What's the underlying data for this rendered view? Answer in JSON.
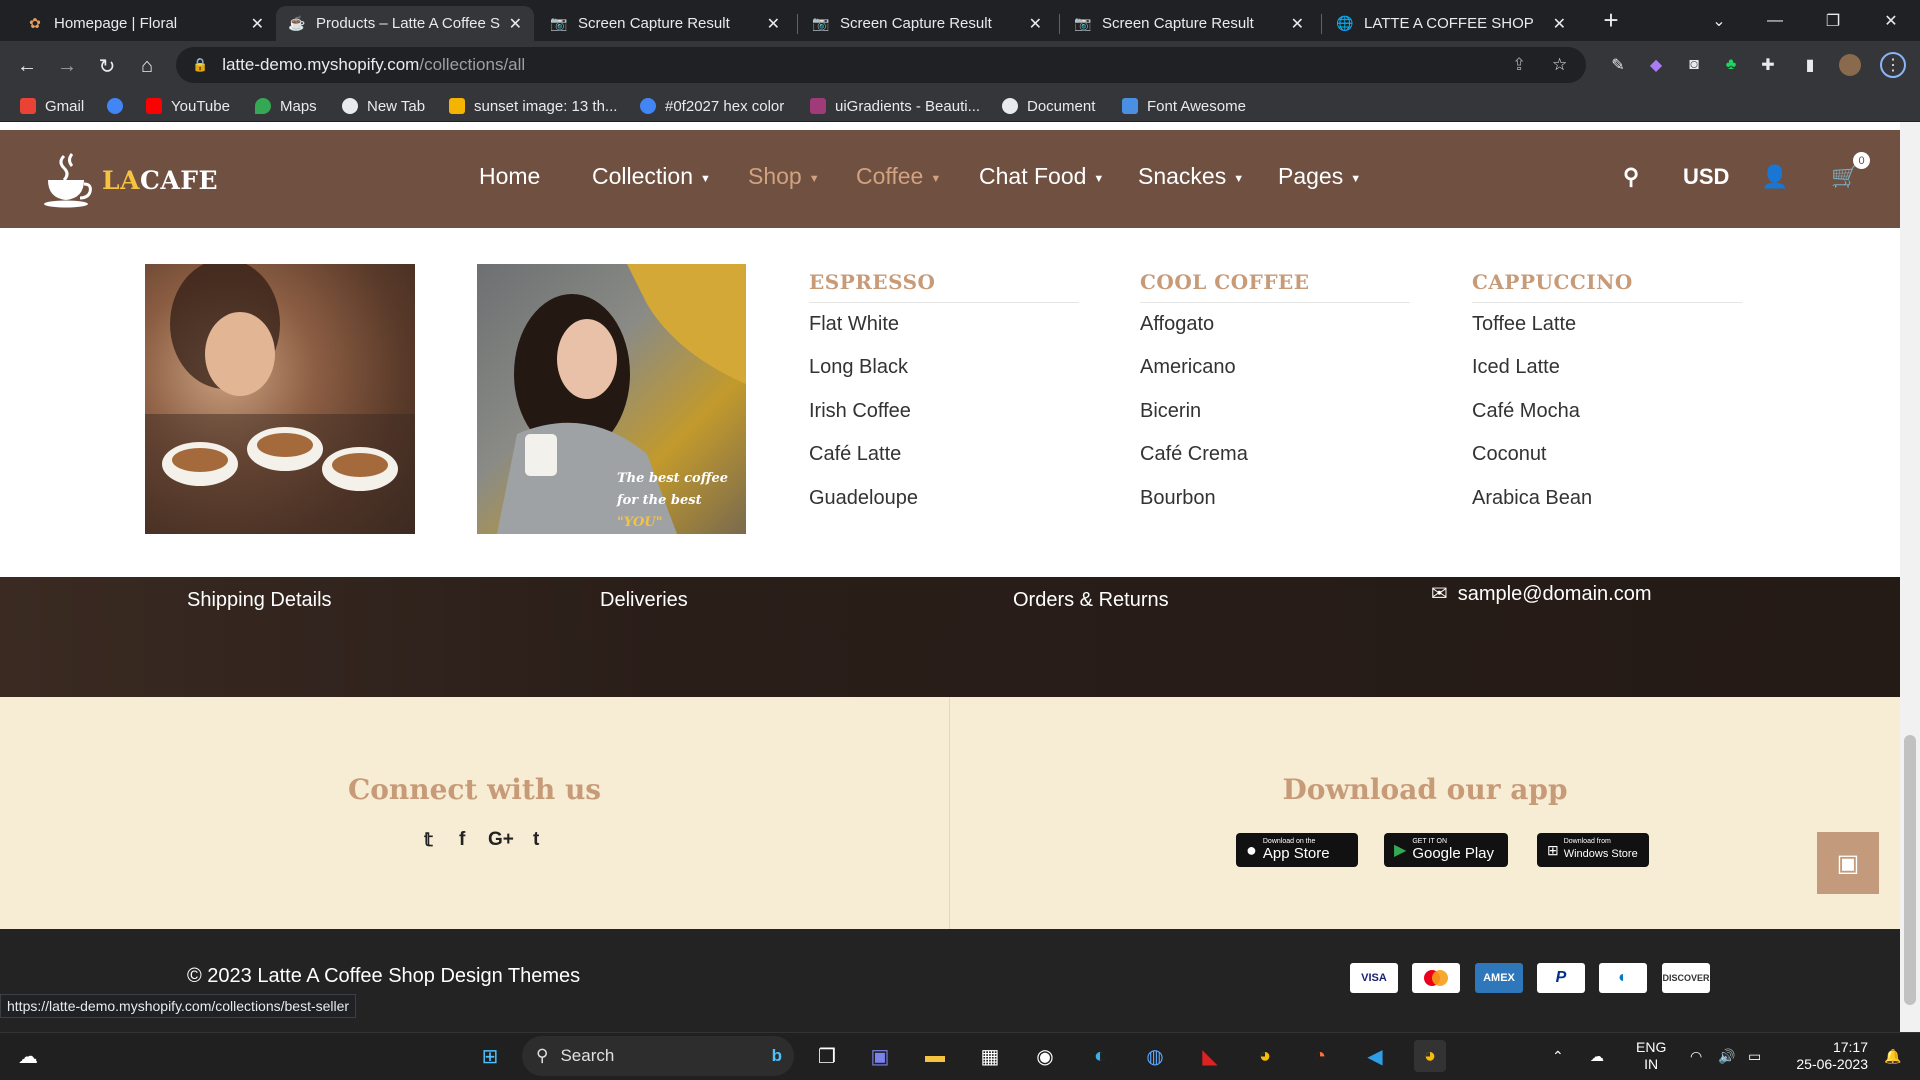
{
  "browser": {
    "tabs": [
      {
        "title": "Homepage | Floral",
        "icon": "floral-icon"
      },
      {
        "title": "Products – Latte A Coffee S",
        "icon": "coffee-icon",
        "active": true
      },
      {
        "title": "Screen Capture Result",
        "icon": "camera-icon"
      },
      {
        "title": "Screen Capture Result",
        "icon": "camera-icon"
      },
      {
        "title": "Screen Capture Result",
        "icon": "camera-icon"
      },
      {
        "title": "LATTE A COFFEE SHOP",
        "icon": "globe-icon"
      }
    ],
    "url_domain": "latte-demo.myshopify.com",
    "url_path": "/collections/all",
    "bookmarks": [
      {
        "label": "Gmail",
        "color": "#ea4335"
      },
      {
        "label": "",
        "color": "#4285f4"
      },
      {
        "label": "YouTube",
        "color": "#ff0000"
      },
      {
        "label": "Maps",
        "color": "#34a853"
      },
      {
        "label": "New Tab",
        "color": "#e8eaed"
      },
      {
        "label": "sunset image: 13 th...",
        "color": "#f4b400"
      },
      {
        "label": "#0f2027 hex color",
        "color": "#4285f4"
      },
      {
        "label": "uiGradients - Beauti...",
        "color": "#a03a78"
      },
      {
        "label": "Document",
        "color": "#e8eaed"
      },
      {
        "label": "Font Awesome",
        "color": "#4a90e2"
      }
    ],
    "status_url": "https://latte-demo.myshopify.com/collections/best-seller"
  },
  "site": {
    "logo_la": "LA",
    "logo_cafe": "CAFE",
    "nav": [
      {
        "label": "Home",
        "caret": false
      },
      {
        "label": "Collection",
        "caret": true
      },
      {
        "label": "Shop",
        "caret": true
      },
      {
        "label": "Coffee",
        "caret": true
      },
      {
        "label": "Chat Food",
        "caret": true
      },
      {
        "label": "Snackes",
        "caret": true
      },
      {
        "label": "Pages",
        "caret": true
      }
    ],
    "currency": "USD",
    "cart_count": "0",
    "promo_caption_1": "The best coffee",
    "promo_caption_2": "for the best",
    "promo_caption_3": "\"YOU\"",
    "menu_columns": [
      {
        "title": "ESPRESSO",
        "items": [
          "Flat White",
          "Long Black",
          "Irish Coffee",
          "Café Latte",
          "Guadeloupe"
        ]
      },
      {
        "title": "COOL COFFEE",
        "items": [
          "Affogato",
          "Americano",
          "Bicerin",
          "Café Crema",
          "Bourbon"
        ]
      },
      {
        "title": "CAPPUCCINO",
        "items": [
          "Toffee Latte",
          "Iced Latte",
          "Café Mocha",
          "Coconut",
          "Arabica Bean"
        ]
      }
    ],
    "footer_links": [
      "Shipping Details",
      "Deliveries",
      "Orders & Returns"
    ],
    "footer_email": "sample@domain.com",
    "connect_title": "Connect with us",
    "download_title": "Download our app",
    "stores": [
      {
        "small": "Download on the",
        "big": "App Store"
      },
      {
        "small": "GET IT ON",
        "big": "Google Play"
      },
      {
        "small": "Download from",
        "big": "Windows Store"
      }
    ],
    "copyright": "© 2023 Latte A Coffee Shop Design Themes",
    "payments": [
      "VISA",
      "MC",
      "AMEX",
      "PayPal",
      "Diners",
      "DISCOVER"
    ]
  },
  "taskbar": {
    "search_label": "Search",
    "lang_1": "ENG",
    "lang_2": "IN",
    "time": "17:17",
    "date": "25-06-2023"
  }
}
